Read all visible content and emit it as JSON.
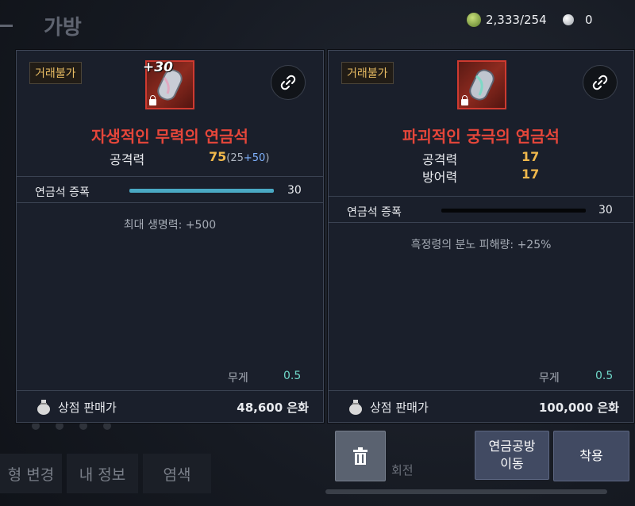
{
  "header": {
    "title": "가방",
    "currency_amount": "2,333/254",
    "pearl_amount": "0"
  },
  "background": {
    "tabs": [
      "형 변경",
      "내 정보",
      "염색"
    ],
    "dim_text": "회전"
  },
  "left_item": {
    "badge": "거래불가",
    "enhance": "+30",
    "name": "자생적인 무력의 연금석",
    "stats": [
      {
        "label": "공격력",
        "value": "75",
        "base": "25",
        "bonus": "+50"
      }
    ],
    "amp_label": "연금석 증폭",
    "amp_value": "30",
    "amp_fill": 1.0,
    "effect": "최대 생명력: +500",
    "weight_label": "무게",
    "weight_value": "0.5",
    "sell_label": "상점 판매가",
    "sell_value": "48,600 은화",
    "icon": "link-icon",
    "accent": "#e5463a"
  },
  "right_item": {
    "badge": "거래불가",
    "name": "파괴적인 궁극의 연금석",
    "stats": [
      {
        "label": "공격력",
        "value": "17"
      },
      {
        "label": "방어력",
        "value": "17"
      }
    ],
    "amp_label": "연금석 증폭",
    "amp_value": "30",
    "amp_fill": 1.0,
    "effect": "흑정령의 분노 피해량: +25%",
    "weight_label": "무게",
    "weight_value": "0.5",
    "sell_label": "상점 판매가",
    "sell_value": "100,000 은화",
    "icon": "link-icon"
  },
  "actions": {
    "trash": "trash-icon",
    "move": "연금공방 이동",
    "equip": "착용"
  }
}
